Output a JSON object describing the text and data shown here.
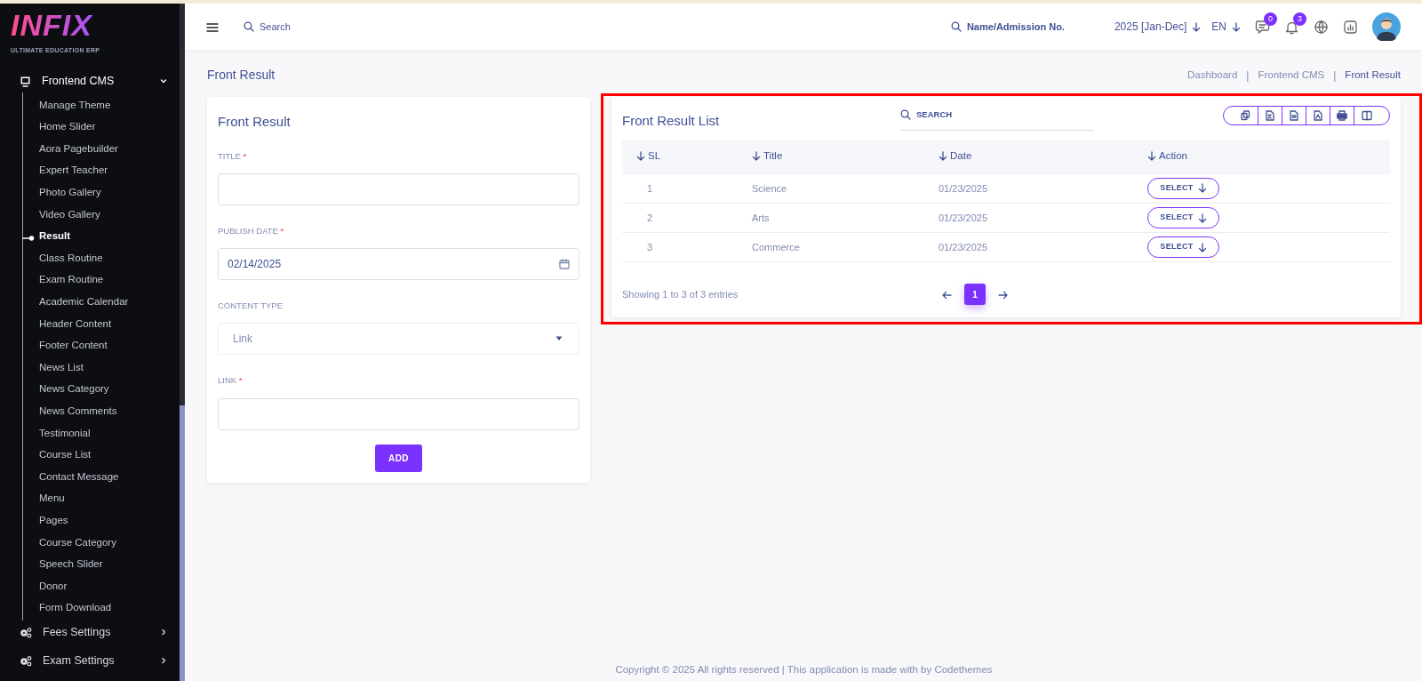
{
  "logo": {
    "text": "INFIX",
    "tagline": "ULTIMATE EDUCATION ERP"
  },
  "sidebar": {
    "groups": [
      {
        "label": "Frontend CMS",
        "expanded": true,
        "children": [
          {
            "label": "Manage Theme",
            "selected": false
          },
          {
            "label": "Home Slider",
            "selected": false
          },
          {
            "label": "Aora Pagebuilder",
            "selected": false
          },
          {
            "label": "Expert Teacher",
            "selected": false
          },
          {
            "label": "Photo Gallery",
            "selected": false
          },
          {
            "label": "Video Gallery",
            "selected": false
          },
          {
            "label": "Result",
            "selected": true
          },
          {
            "label": "Class Routine",
            "selected": false
          },
          {
            "label": "Exam Routine",
            "selected": false
          },
          {
            "label": "Academic Calendar",
            "selected": false
          },
          {
            "label": "Header Content",
            "selected": false
          },
          {
            "label": "Footer Content",
            "selected": false
          },
          {
            "label": "News List",
            "selected": false
          },
          {
            "label": "News Category",
            "selected": false
          },
          {
            "label": "News Comments",
            "selected": false
          },
          {
            "label": "Testimonial",
            "selected": false
          },
          {
            "label": "Course List",
            "selected": false
          },
          {
            "label": "Contact Message",
            "selected": false
          },
          {
            "label": "Menu",
            "selected": false
          },
          {
            "label": "Pages",
            "selected": false
          },
          {
            "label": "Course Category",
            "selected": false
          },
          {
            "label": "Speech Slider",
            "selected": false
          },
          {
            "label": "Donor",
            "selected": false
          },
          {
            "label": "Form Download",
            "selected": false
          }
        ]
      },
      {
        "label": "Fees Settings",
        "expanded": false
      },
      {
        "label": "Exam Settings",
        "expanded": false
      }
    ]
  },
  "topbar": {
    "search_placeholder": "Search",
    "student_search_placeholder": "Name/Admission No.",
    "session": "2025 [Jan-Dec]",
    "language": "EN",
    "messages_count": "0",
    "notifications_count": "3"
  },
  "page_title": "Front Result",
  "breadcrumb": [
    "Dashboard",
    "Frontend CMS",
    "Front Result"
  ],
  "breadcrumb_separator": "|",
  "form": {
    "title": "Front Result",
    "fields": [
      {
        "kind": "text",
        "label": "TITLE",
        "required_mark": "*"
      },
      {
        "kind": "date",
        "label": "PUBLISH DATE",
        "required_mark": "*",
        "value": "02/14/2025"
      },
      {
        "kind": "select",
        "label": "CONTENT TYPE",
        "value": "Link"
      },
      {
        "kind": "text",
        "label": "LINK",
        "required_mark": "*"
      }
    ],
    "button": "ADD"
  },
  "list": {
    "title": "Front Result List",
    "search_placeholder": "SEARCH",
    "columns": [
      "SL",
      "Title",
      "Date",
      "Action"
    ],
    "rows": [
      {
        "sl": "1",
        "title": "Science",
        "date": "01/23/2025",
        "action": "SELECT"
      },
      {
        "sl": "2",
        "title": "Arts",
        "date": "01/23/2025",
        "action": "SELECT"
      },
      {
        "sl": "3",
        "title": "Commerce",
        "date": "01/23/2025",
        "action": "SELECT"
      }
    ],
    "info": "Showing 1 to 3 of 3 entries",
    "pages": [
      {
        "label": "1",
        "selected": true
      }
    ]
  },
  "footer": "Copyright © 2025 All rights reserved | This application is made with by Codethemes"
}
